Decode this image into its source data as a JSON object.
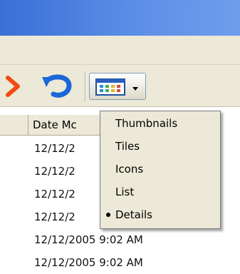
{
  "colors": {
    "titlebar": "#3a6fd6",
    "chrome": "#ece9d8",
    "delete_icon": "#f24b12",
    "undo_icon": "#1c67d8"
  },
  "toolbar": {
    "delete_icon": "delete-x-icon",
    "undo_icon": "undo-icon",
    "views_icon": "views-grid-icon",
    "views_dropdown_icon": "chevron-down-icon"
  },
  "list": {
    "columns": [
      {
        "label": ""
      },
      {
        "label": "Date Mc"
      }
    ],
    "rows": [
      {
        "date": "12/12/2"
      },
      {
        "date": "12/12/2"
      },
      {
        "date": "12/12/2"
      },
      {
        "date": "12/12/2"
      },
      {
        "date": "12/12/2005 9:02 AM"
      },
      {
        "date": "12/12/2005 9:02 AM"
      }
    ]
  },
  "views_menu": {
    "items": [
      {
        "label": "Thumbnails",
        "selected": false
      },
      {
        "label": "Tiles",
        "selected": false
      },
      {
        "label": "Icons",
        "selected": false
      },
      {
        "label": "List",
        "selected": false
      },
      {
        "label": "Details",
        "selected": true
      }
    ]
  }
}
